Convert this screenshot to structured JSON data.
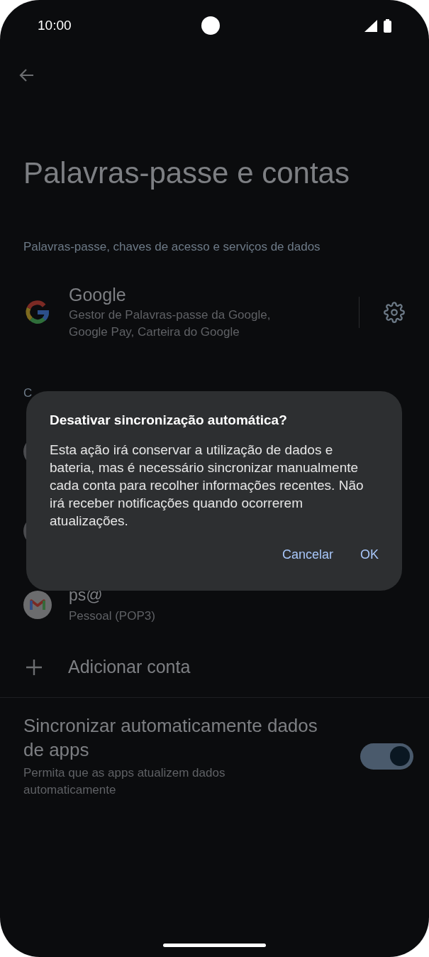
{
  "status_bar": {
    "time": "10:00"
  },
  "title": "Palavras-passe e contas",
  "services_section": {
    "header": "Palavras-passe, chaves de acesso e serviços de dados",
    "items": [
      {
        "title": "Google",
        "subtitle": "Gestor de Palavras-passe da Google, Google Pay, Carteira do Google"
      }
    ]
  },
  "accounts_section": {
    "header": "C",
    "accounts": [
      {
        "kind": "hidden"
      },
      {
        "kind": "hidden"
      },
      {
        "kind": "mail",
        "name": "ps@",
        "type": "Pessoal (POP3)"
      }
    ],
    "add_account": "Adicionar conta"
  },
  "sync_setting": {
    "title": "Sincronizar automaticamente dados de apps",
    "subtitle": "Permita que as apps atualizem dados automaticamente",
    "on": true
  },
  "dialog": {
    "title": "Desativar sincronização automática?",
    "message": "Esta ação irá conservar a utilização de dados e bateria, mas é necessário sincronizar manualmente cada conta para recolher informações recentes. Não irá receber notificações quando ocorrerem atualizações.",
    "buttons": [
      "Cancelar",
      "OK"
    ]
  }
}
